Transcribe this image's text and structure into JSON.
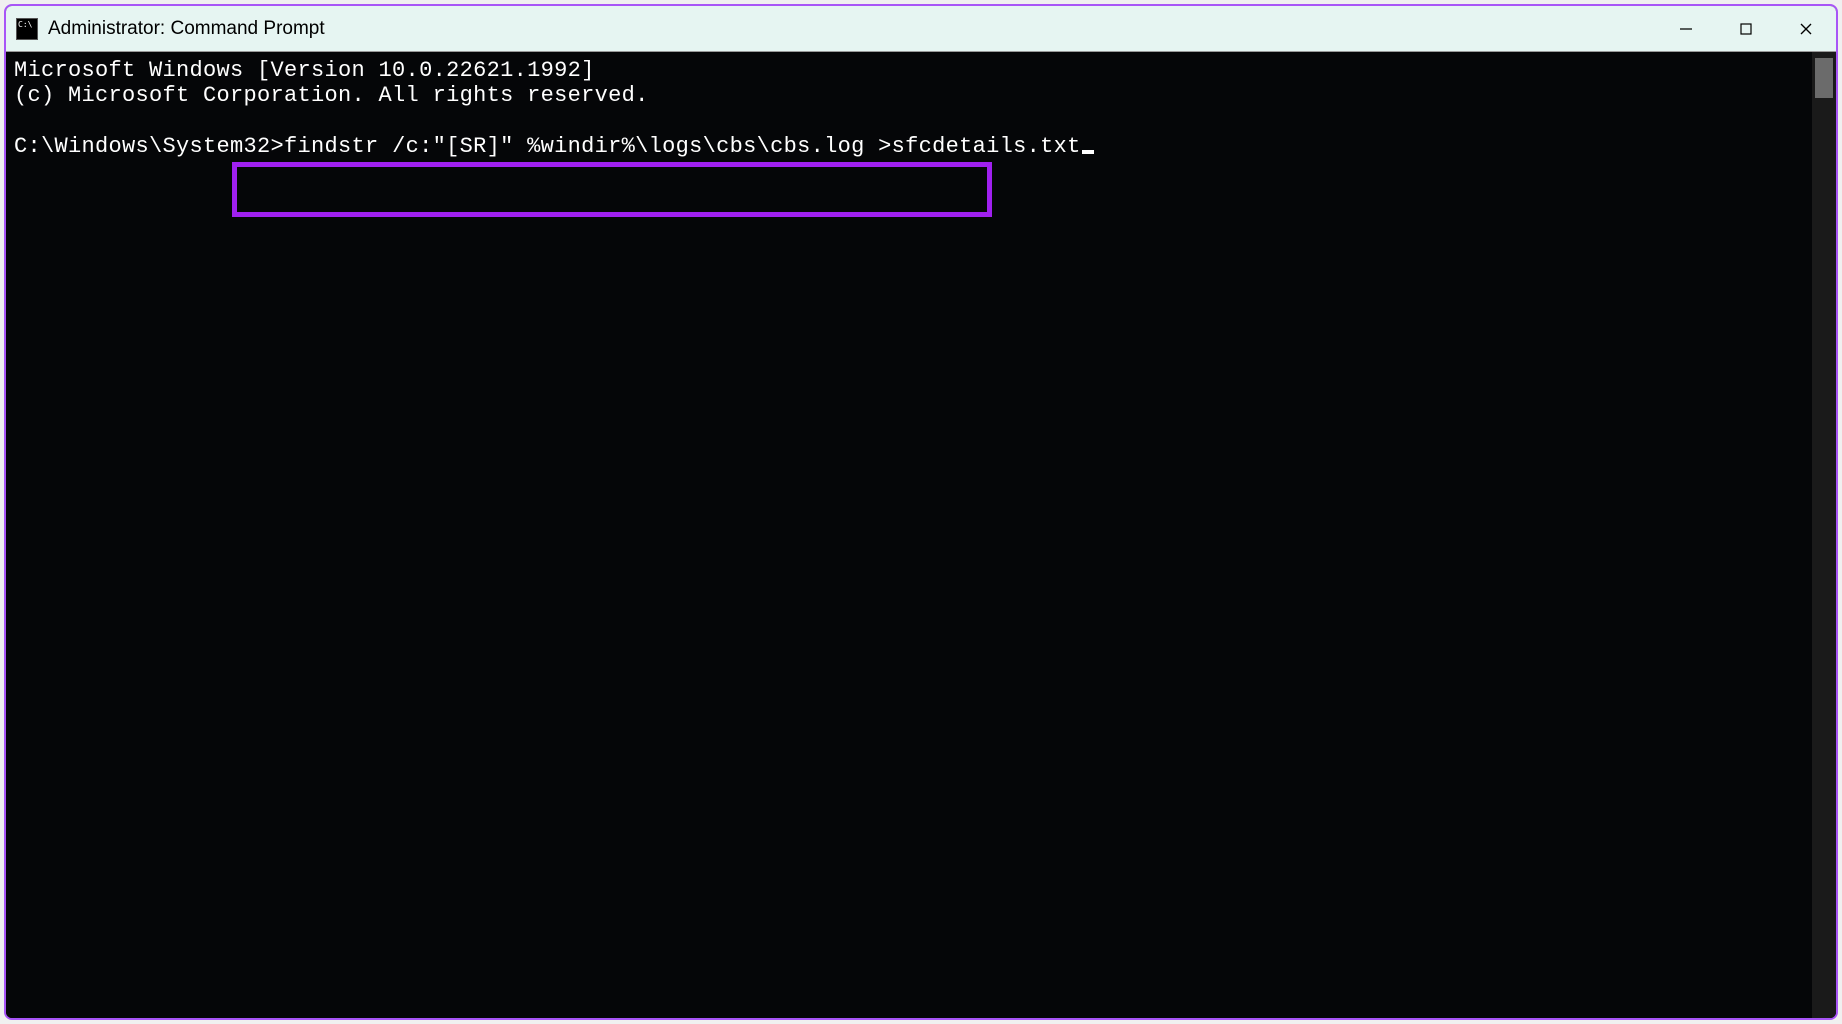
{
  "window": {
    "title": "Administrator: Command Prompt",
    "icon_name": "cmd-icon"
  },
  "terminal": {
    "header_line1": "Microsoft Windows [Version 10.0.22621.1992]",
    "header_line2": "(c) Microsoft Corporation. All rights reserved.",
    "prompt_path": "C:\\Windows\\System32>",
    "command": "findstr /c:\"[SR]\" %windir%\\logs\\cbs\\cbs.log >sfcdetails.txt"
  },
  "controls": {
    "minimize_label": "Minimize",
    "maximize_label": "Maximize",
    "close_label": "Close"
  }
}
